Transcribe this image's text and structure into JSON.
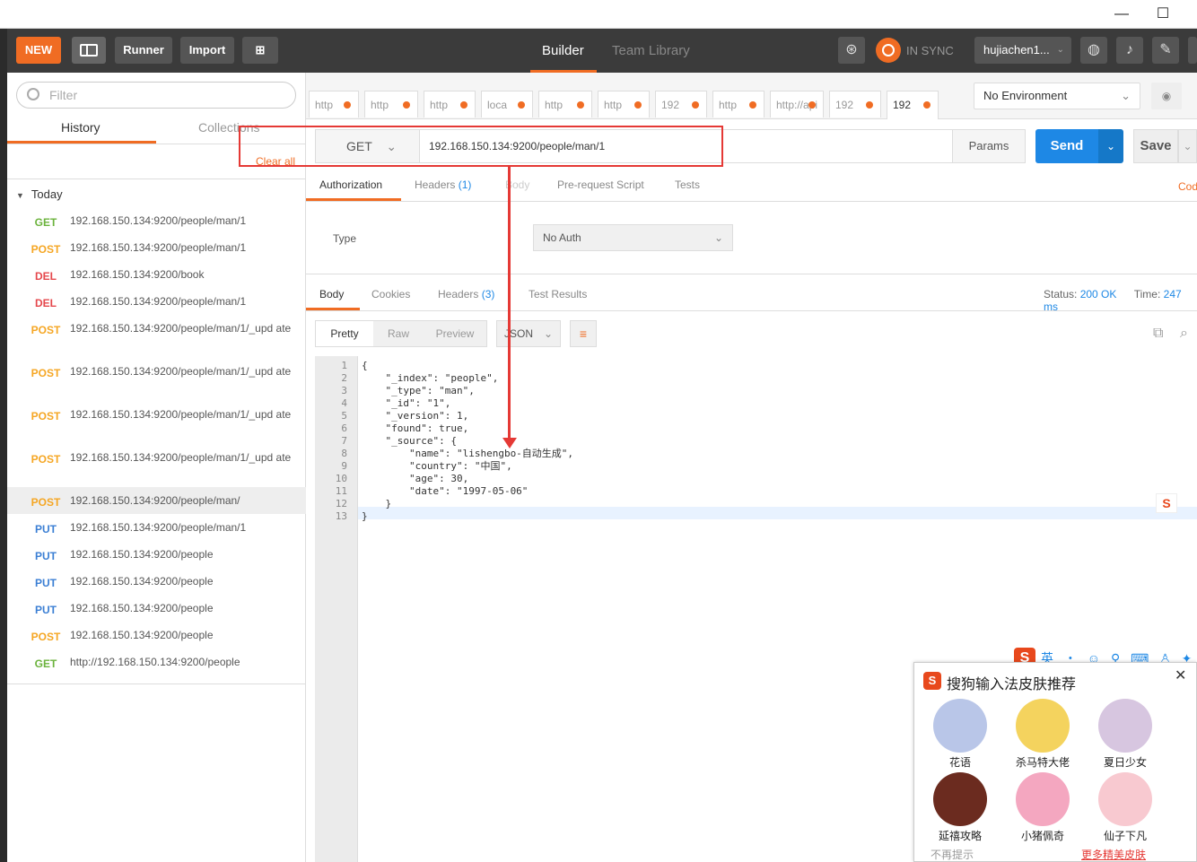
{
  "toolbar": {
    "new_label": "NEW",
    "runner_label": "Runner",
    "import_label": "Import",
    "builder_label": "Builder",
    "team_label": "Team Library",
    "sync_label": "IN SYNC",
    "user_label": "hujiachen1..."
  },
  "sidebar": {
    "filter_placeholder": "Filter",
    "history_tab": "History",
    "collections_tab": "Collections",
    "clear_all": "Clear all",
    "group_label": "Today",
    "items": [
      {
        "method": "GET",
        "url": "192.168.150.134:9200/people/man/1"
      },
      {
        "method": "POST",
        "url": "192.168.150.134:9200/people/man/1"
      },
      {
        "method": "DEL",
        "url": "192.168.150.134:9200/book"
      },
      {
        "method": "DEL",
        "url": "192.168.150.134:9200/people/man/1"
      },
      {
        "method": "POST",
        "url": "192.168.150.134:9200/people/man/1/_upd ate"
      },
      {
        "method": "POST",
        "url": "192.168.150.134:9200/people/man/1/_upd ate"
      },
      {
        "method": "POST",
        "url": "192.168.150.134:9200/people/man/1/_upd ate"
      },
      {
        "method": "POST",
        "url": "192.168.150.134:9200/people/man/1/_upd ate"
      },
      {
        "method": "POST",
        "url": "192.168.150.134:9200/people/man/"
      },
      {
        "method": "PUT",
        "url": "192.168.150.134:9200/people/man/1"
      },
      {
        "method": "PUT",
        "url": "192.168.150.134:9200/people"
      },
      {
        "method": "PUT",
        "url": "192.168.150.134:9200/people"
      },
      {
        "method": "PUT",
        "url": "192.168.150.134:9200/people"
      },
      {
        "method": "POST",
        "url": "192.168.150.134:9200/people"
      },
      {
        "method": "GET",
        "url": "http://192.168.150.134:9200/people"
      }
    ]
  },
  "request_tabs": [
    "http",
    "http",
    "http",
    "loca",
    "http",
    "http",
    "192",
    "http",
    "http://api",
    "192",
    "192"
  ],
  "environment": "No Environment",
  "request": {
    "method": "GET",
    "url": "192.168.150.134:9200/people/man/1",
    "params_label": "Params",
    "send_label": "Send",
    "save_label": "Save"
  },
  "request_subtabs": {
    "authorization": "Authorization",
    "headers": "Headers",
    "headers_count": "(1)",
    "body": "Body",
    "prerequest": "Pre-request Script",
    "tests": "Tests",
    "code": "Cod"
  },
  "auth": {
    "type_label": "Type",
    "type_value": "No Auth"
  },
  "response": {
    "body_tab": "Body",
    "cookies_tab": "Cookies",
    "headers_tab": "Headers",
    "headers_count": "(3)",
    "tests_tab": "Test Results",
    "status_label": "Status:",
    "status_value": "200 OK",
    "time_label": "Time:",
    "time_value": "247 ms",
    "view_pretty": "Pretty",
    "view_raw": "Raw",
    "view_preview": "Preview",
    "format": "JSON"
  },
  "code_lines": [
    "{",
    "    \"_index\": \"people\",",
    "    \"_type\": \"man\",",
    "    \"_id\": \"1\",",
    "    \"_version\": 1,",
    "    \"found\": true,",
    "    \"_source\": {",
    "        \"name\": \"lishengbo-自动生成\",",
    "        \"country\": \"中国\",",
    "        \"age\": 30,",
    "        \"date\": \"1997-05-06\"",
    "    }",
    "}"
  ],
  "ime": {
    "lang": "英",
    "popup_title": "搜狗输入法皮肤推荐",
    "skins": [
      "花语",
      "杀马特大佬",
      "夏日少女",
      "延禧攻略",
      "小猪佩奇",
      "仙子下凡"
    ],
    "no_show": "不再提示",
    "more": "更多精美皮肤"
  },
  "colors": {
    "accent": "#f06c23",
    "send": "#1e88e5",
    "highlight": "#e53935"
  }
}
